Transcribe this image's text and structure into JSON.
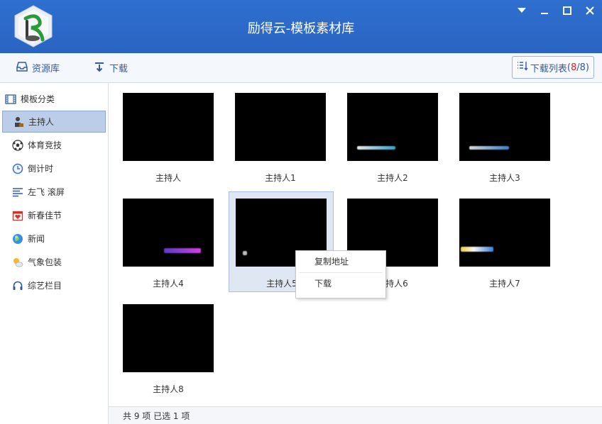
{
  "window": {
    "title": "励得云-模板素材库",
    "controls": [
      "dropdown-icon",
      "minimize-icon",
      "maximize-icon",
      "close-icon"
    ]
  },
  "toolbar": {
    "library_label": "资源库",
    "download_label": "下载",
    "download_list": {
      "label": "下载列表",
      "open_paren": "(",
      "current": "8",
      "slash_total": "/8",
      "close_paren": ")"
    }
  },
  "sidebar": {
    "header": "模板分类",
    "items": [
      {
        "label": "主持人",
        "icon": "person-icon",
        "active": true
      },
      {
        "label": "体育竞技",
        "icon": "soccer-ball-icon"
      },
      {
        "label": "倒计时",
        "icon": "clock-icon"
      },
      {
        "label": "左飞 滚屏",
        "icon": "scroll-text-icon"
      },
      {
        "label": "新春佳节",
        "icon": "calendar-heart-icon"
      },
      {
        "label": "新闻",
        "icon": "globe-icon"
      },
      {
        "label": "气象包装",
        "icon": "weather-icon"
      },
      {
        "label": "综艺栏目",
        "icon": "headphones-icon"
      }
    ]
  },
  "grid": {
    "items": [
      {
        "label": "主持人"
      },
      {
        "label": "主持人1"
      },
      {
        "label": "主持人2"
      },
      {
        "label": "主持人3"
      },
      {
        "label": "主持人4"
      },
      {
        "label": "主持人5",
        "selected": true
      },
      {
        "label": "主持人6"
      },
      {
        "label": "主持人7"
      },
      {
        "label": "主持人8"
      }
    ]
  },
  "context_menu": {
    "items": [
      {
        "label": "复制地址"
      },
      {
        "label": "下载"
      }
    ]
  },
  "status": {
    "text": "共 9 项 已选 1 项"
  },
  "colors": {
    "titlebar": "#2f6fcf",
    "accent": "#2e5aa8",
    "count": "#e02020",
    "selection": "#bccde9"
  }
}
